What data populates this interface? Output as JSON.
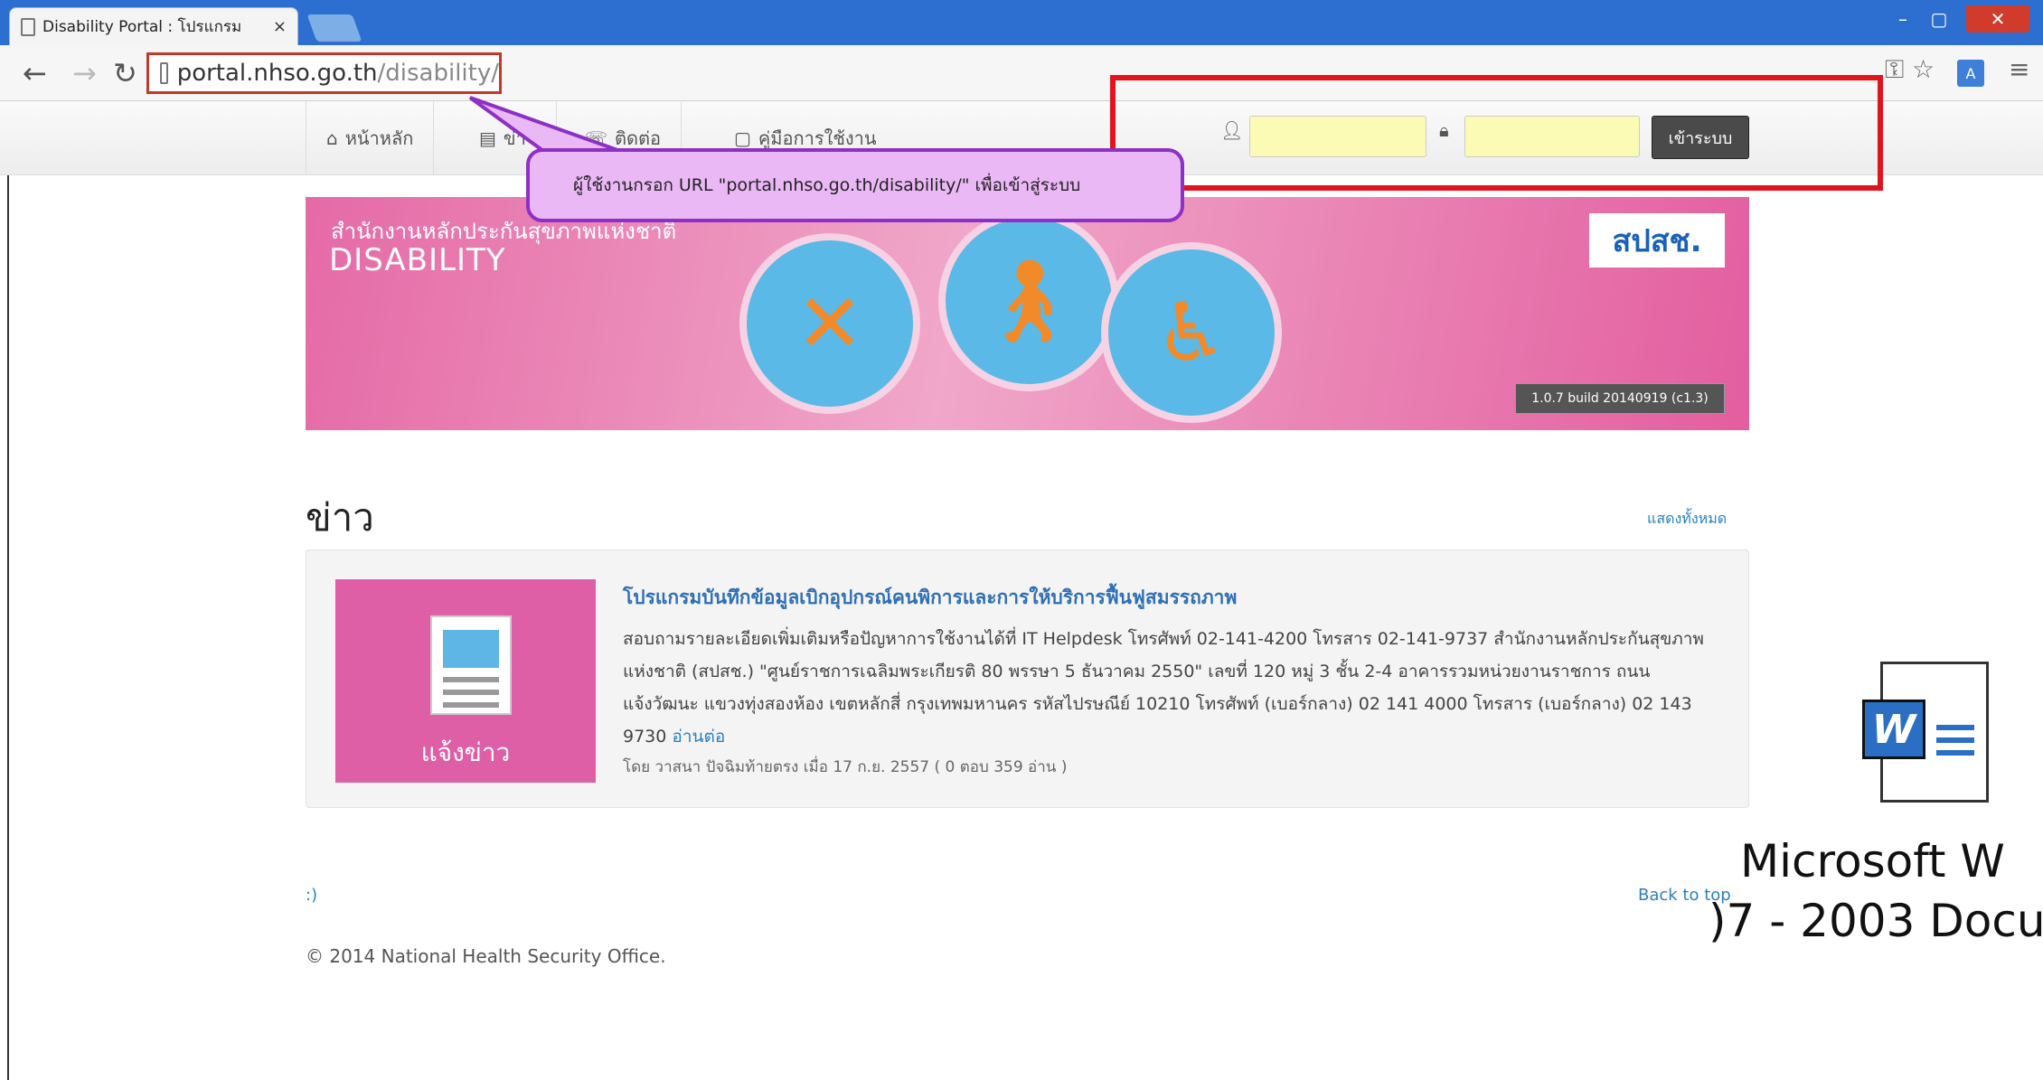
{
  "browser": {
    "tab_title": "Disability Portal : โปรแกรม",
    "tab_close": "×",
    "url_host": "portal.nhso.go.th",
    "url_path": "/disability/",
    "window_min": "–",
    "window_max": "▢",
    "window_close": "✕"
  },
  "nav": {
    "home": "หน้าหลัก",
    "news": "ข่าว",
    "contact": "ติดต่อ",
    "manual": "คู่มือการใช้งาน"
  },
  "login": {
    "username_value": "",
    "password_value": "",
    "submit": "เข้าระบบ"
  },
  "callout": {
    "text": "ผู้ใช้งานกรอก URL \"portal.nhso.go.th/disability/\" เพื่อเข้าสู่ระบบ"
  },
  "banner": {
    "subtitle": "สำนักงานหลักประกันสุขภาพแห่งชาติ",
    "title": "DISABILITY",
    "logo": "สปสช.",
    "version": "1.0.7 build 20140919 (c1.3)"
  },
  "news": {
    "heading": "ข่าว",
    "show_all": "แสดงทั้งหมด",
    "thumb_label": "แจ้งข่าว",
    "item_title": "โปรแกรมบันทึกข้อมูลเบิกอุปกรณ์คนพิการและการให้บริการฟื้นฟูสมรรถภาพ",
    "item_body": "สอบถามรายละเอียดเพิ่มเติมหรือปัญหาการใช้งานได้ที่ IT Helpdesk โทรศัพท์ 02-141-4200 โทรสาร 02-141-9737 สำนักงานหลักประกันสุขภาพแห่งชาติ (สปสช.) \"ศูนย์ราชการเฉลิมพระเกียรติ 80 พรรษา 5 ธันวาคม 2550\" เลขที่ 120 หมู่ 3 ชั้น 2-4 อาคารรวมหน่วยงานราชการ ถนนแจ้งวัฒนะ แขวงทุ่งสองห้อง เขตหลักสี่ กรุงเทพมหานคร รหัสไปรษณีย์ 10210 โทรศัพท์ (เบอร์กลาง) 02 141 4000 โทรสาร (เบอร์กลาง) 02 143 9730",
    "read_more": "อ่านต่อ",
    "item_meta": "โดย วาสนา ปัจฉิมท้ายตรง เมื่อ 17 ก.ย. 2557 ( 0 ตอบ 359 อ่าน )"
  },
  "footer": {
    "left": ":)",
    "back_to_top": "Back to top",
    "copyright": "© 2014 National Health Security Office."
  },
  "desktop_icon": {
    "badge": "W",
    "label_line1": "Microsoft W",
    "label_line2": ")7 - 2003 Docu"
  }
}
